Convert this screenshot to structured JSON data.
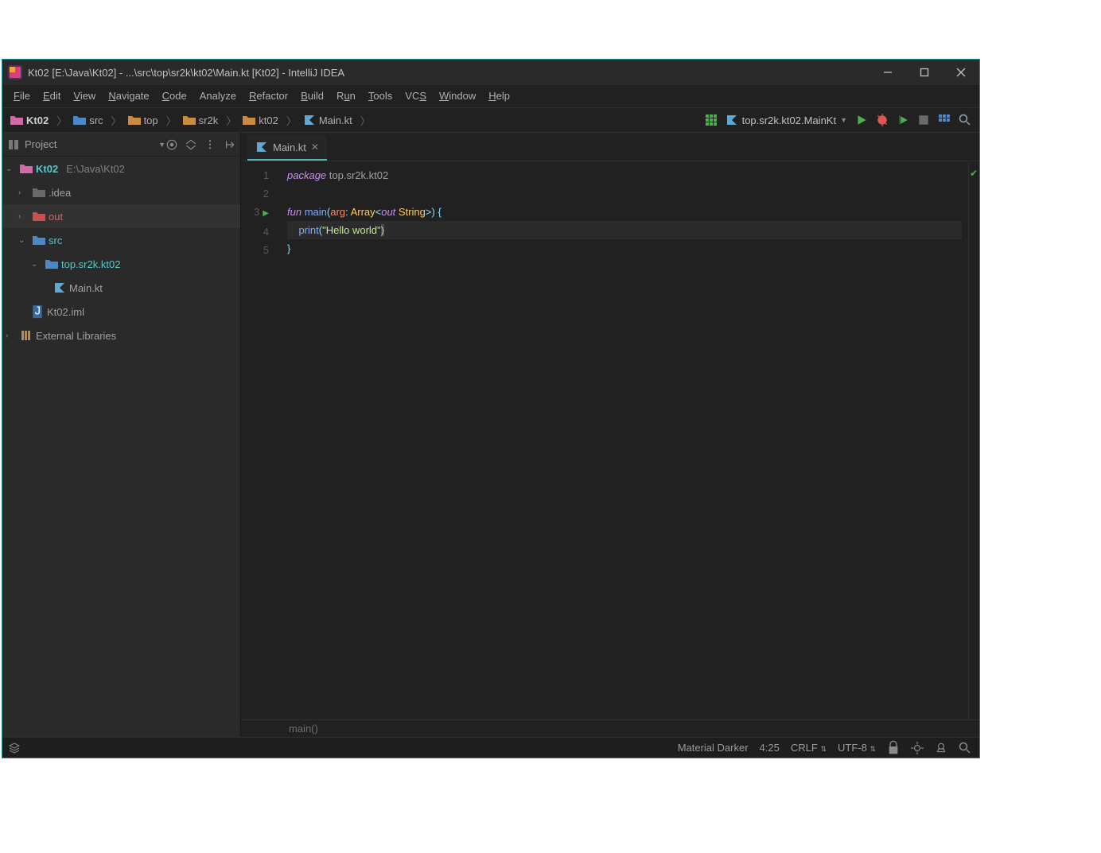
{
  "window": {
    "title": "Kt02 [E:\\Java\\Kt02] - ...\\src\\top\\sr2k\\kt02\\Main.kt [Kt02] - IntelliJ IDEA"
  },
  "menu": {
    "file": "File",
    "edit": "Edit",
    "view": "View",
    "navigate": "Navigate",
    "code": "Code",
    "analyze": "Analyze",
    "refactor": "Refactor",
    "build": "Build",
    "run": "Run",
    "tools": "Tools",
    "vcs": "VCS",
    "window": "Window",
    "help": "Help"
  },
  "breadcrumbs": {
    "c0": "Kt02",
    "c1": "src",
    "c2": "top",
    "c3": "sr2k",
    "c4": "kt02",
    "c5": "Main.kt"
  },
  "run_config": "top.sr2k.kt02.MainKt",
  "sidebar": {
    "title": "Project",
    "root_name": "Kt02",
    "root_path": "E:\\Java\\Kt02",
    "idea": ".idea",
    "out": "out",
    "src": "src",
    "pkg": "top.sr2k.kt02",
    "file": "Main.kt",
    "iml": "Kt02.iml",
    "extlib": "External Libraries"
  },
  "tab": {
    "name": "Main.kt"
  },
  "gutter": {
    "l1": "1",
    "l2": "2",
    "l3": "3",
    "l4": "4",
    "l5": "5"
  },
  "code": {
    "kw_package": "package",
    "pkg_name": "top.sr2k.kt02",
    "kw_fun": "fun",
    "fn_main": "main",
    "p_arg": "arg",
    "t_array": "Array",
    "kw_out": "out",
    "t_string": "String",
    "fn_print": "print",
    "str_hello": "\"Hello world\""
  },
  "editor_crumb": "main()",
  "status": {
    "theme": "Material Darker",
    "pos": "4:25",
    "eol": "CRLF",
    "enc": "UTF-8"
  }
}
